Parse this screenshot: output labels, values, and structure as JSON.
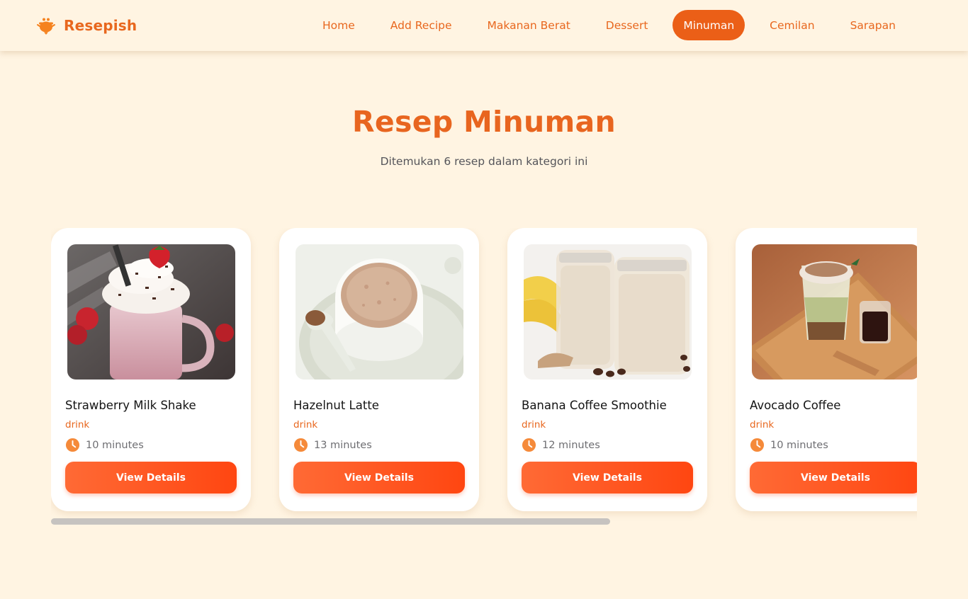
{
  "brand": {
    "name": "Resepish",
    "icon": "cooking-pot-icon"
  },
  "nav": {
    "items": [
      {
        "label": "Home",
        "active": false
      },
      {
        "label": "Add Recipe",
        "active": false
      },
      {
        "label": "Makanan Berat",
        "active": false
      },
      {
        "label": "Dessert",
        "active": false
      },
      {
        "label": "Minuman",
        "active": true
      },
      {
        "label": "Cemilan",
        "active": false
      },
      {
        "label": "Sarapan",
        "active": false
      }
    ]
  },
  "header": {
    "title": "Resep Minuman",
    "subtitle": "Ditemukan 6 resep dalam kategori ini"
  },
  "recipes": [
    {
      "title": "Strawberry Milk Shake",
      "category": "drink",
      "time": "10 minutes",
      "button": "View Details",
      "image": "strawberry-milkshake-photo"
    },
    {
      "title": "Hazelnut Latte",
      "category": "drink",
      "time": "13 minutes",
      "button": "View Details",
      "image": "hazelnut-latte-photo"
    },
    {
      "title": "Banana Coffee Smoothie",
      "category": "drink",
      "time": "12 minutes",
      "button": "View Details",
      "image": "banana-coffee-smoothie-photo"
    },
    {
      "title": "Avocado Coffee",
      "category": "drink",
      "time": "10 minutes",
      "button": "View Details",
      "image": "avocado-coffee-photo"
    }
  ],
  "carousel": {
    "scroll_position": 0.0
  },
  "colors": {
    "accent": "#e8671e",
    "active_pill": "#eb5f17",
    "button_gradient_start": "#ff6a35",
    "button_gradient_end": "#ff4611",
    "background": "#fff4e2"
  }
}
